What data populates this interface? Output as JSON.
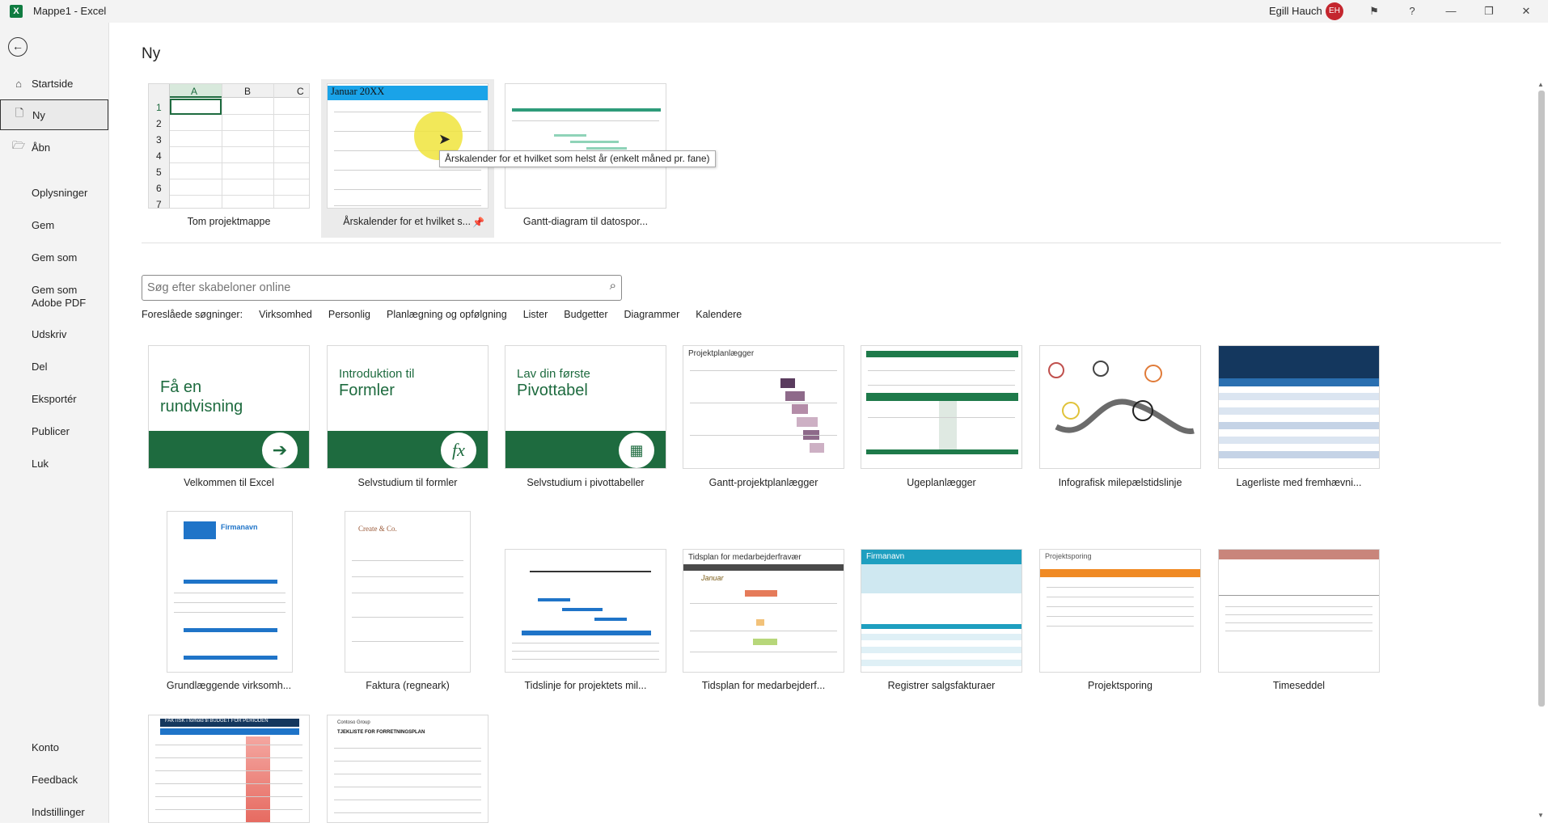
{
  "window": {
    "title": "Mappe1  -  Excel",
    "app_icon": "X",
    "user_name": "Egill Hauch",
    "user_initials": "EH"
  },
  "sidebar": {
    "items": [
      {
        "label": "Startside",
        "icon": "home-icon"
      },
      {
        "label": "Ny",
        "icon": "new-file-icon"
      },
      {
        "label": "Åbn",
        "icon": "folder-open-icon"
      },
      {
        "label": "Oplysninger"
      },
      {
        "label": "Gem"
      },
      {
        "label": "Gem som"
      },
      {
        "label": "Gem som Adobe PDF"
      },
      {
        "label": "Udskriv"
      },
      {
        "label": "Del"
      },
      {
        "label": "Eksportér"
      },
      {
        "label": "Publicer"
      },
      {
        "label": "Luk"
      },
      {
        "label": "Konto"
      },
      {
        "label": "Feedback"
      },
      {
        "label": "Indstillinger"
      }
    ]
  },
  "main": {
    "title": "Ny",
    "featured": [
      {
        "label": "Tom projektmappe"
      },
      {
        "label": "Årskalender for et hvilket s..."
      },
      {
        "label": "Gantt-diagram til datospor..."
      }
    ],
    "blank_columns": [
      "A",
      "B",
      "C"
    ],
    "blank_rows": [
      "1",
      "2",
      "3",
      "4",
      "5",
      "6",
      "7"
    ],
    "calendar_header": "Januar 20XX",
    "tooltip": "Årskalender for et hvilket som helst år (enkelt måned pr. fane)",
    "search": {
      "placeholder": "Søg efter skabeloner online"
    },
    "suggested_label": "Foreslåede søgninger:",
    "suggested": [
      "Virksomhed",
      "Personlig",
      "Planlægning og opfølgning",
      "Lister",
      "Budgetter",
      "Diagrammer",
      "Kalendere"
    ],
    "templates_row1": [
      {
        "label": "Velkommen til Excel",
        "thumb_line1": "Få en",
        "thumb_line2": "rundvisning"
      },
      {
        "label": "Selvstudium til formler",
        "thumb_line1": "Introduktion til",
        "thumb_line2": "Formler"
      },
      {
        "label": "Selvstudium i pivottabeller",
        "thumb_line1": "Lav din første",
        "thumb_line2": "Pivottabel"
      },
      {
        "label": "Gantt-projektplanlægger",
        "thumb_title": "Projektplanlægger"
      },
      {
        "label": "Ugeplanlægger"
      },
      {
        "label": "Infografisk milepælstidslinje"
      },
      {
        "label": "Lagerliste med fremhævni..."
      }
    ],
    "templates_row2": [
      {
        "label": "Grundlæggende virksomh...",
        "thumb_title": "Firmanavn"
      },
      {
        "label": "Faktura (regneark)",
        "thumb_title": "Create & Co."
      },
      {
        "label": "Tidslinje for projektets mil..."
      },
      {
        "label": "Tidsplan for medarbejderf...",
        "thumb_title": "Tidsplan for medarbejderfravær",
        "thumb_sub": "Januar"
      },
      {
        "label": "Registrer salgsfakturaer",
        "thumb_title": "Firmanavn"
      },
      {
        "label": "Projektsporing",
        "thumb_title": "Projektsporing"
      },
      {
        "label": "Timeseddel"
      }
    ],
    "templates_row3": [
      {
        "thumb_title": "FAKTISK i forhold til BUDGET FOR PERIODEN"
      },
      {
        "thumb_title": "TJEKLISTE FOR FORRETNINGSPLAN",
        "thumb_sub": "Contoso Group"
      }
    ]
  },
  "colors": {
    "excel_green": "#1e6b3f",
    "accent_blue": "#1f74c8",
    "avatar_red": "#c4262e"
  }
}
